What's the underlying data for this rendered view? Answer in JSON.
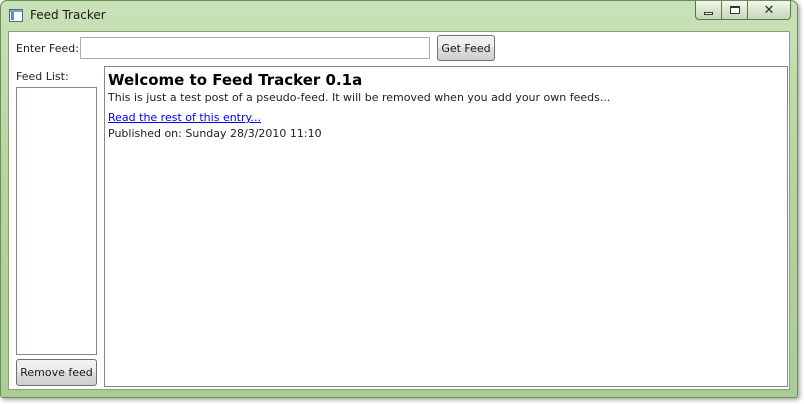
{
  "window": {
    "title": "Feed Tracker",
    "close_glyph": "✕"
  },
  "toolbar": {
    "enter_feed_label": "Enter Feed:",
    "feed_input_value": "",
    "get_feed_label": "Get Feed"
  },
  "sidebar": {
    "feed_list_label": "Feed List:",
    "items": [],
    "remove_feed_label": "Remove feed"
  },
  "post": {
    "title": "Welcome to Feed Tracker 0.1a",
    "body": "This is just a test post of a pseudo-feed. It will be removed when you add your own feeds...",
    "link_text": "Read the rest of this entry...",
    "published": "Published on: Sunday 28/3/2010 11:10"
  },
  "colors": {
    "frame": "#b6d6a0",
    "link": "#0000ee"
  },
  "icons": [
    "app-window-icon",
    "minimize-icon",
    "maximize-icon",
    "close-icon"
  ]
}
